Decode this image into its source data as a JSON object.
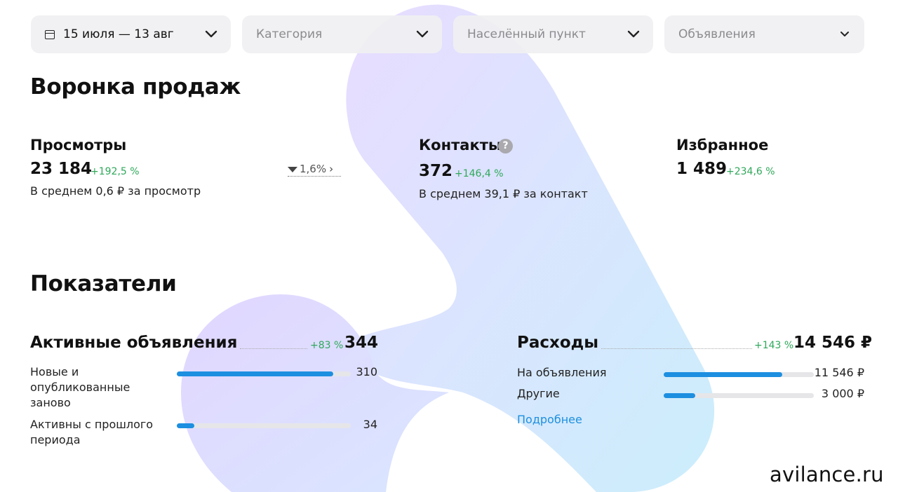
{
  "filters": {
    "period": "15 июля — 13 авг",
    "category_placeholder": "Категория",
    "locality_placeholder": "Населённый пункт",
    "ads_placeholder": "Объявления"
  },
  "funnel": {
    "title": "Воронка продаж",
    "views": {
      "label": "Просмотры",
      "value": "23 184",
      "delta": "+192,5 %",
      "avg": "В среднем 0,6 ₽ за просмотр"
    },
    "conversion": "1,6%",
    "contacts": {
      "label": "Контакты",
      "value": "372",
      "delta": "+146,4 %",
      "avg": "В среднем 39,1 ₽ за контакт"
    },
    "favorites": {
      "label": "Избранное",
      "value": "1 489",
      "delta": "+234,6 %"
    }
  },
  "metrics": {
    "title": "Показатели",
    "active": {
      "title": "Активные объявления",
      "delta": "+83 %",
      "total": "344",
      "rows": [
        {
          "label": "Новые и опубликованные заново",
          "value": "310",
          "fraction": 0.9
        },
        {
          "label": "Активны с прошлого периода",
          "value": "34",
          "fraction": 0.1
        }
      ]
    },
    "expenses": {
      "title": "Расходы",
      "delta": "+143 %",
      "total": "14 546 ₽",
      "rows": [
        {
          "label": "На объявления",
          "value": "11 546 ₽",
          "fraction": 0.79
        },
        {
          "label": "Другие",
          "value": "3 000 ₽",
          "fraction": 0.21
        }
      ],
      "more_link": "Подробнее"
    }
  },
  "watermark": "avilance.ru",
  "colors": {
    "accent": "#1d8fe0",
    "positive": "#2fa85a",
    "logo_purple": "#e6dbff",
    "logo_blue": "#cfeefc"
  }
}
